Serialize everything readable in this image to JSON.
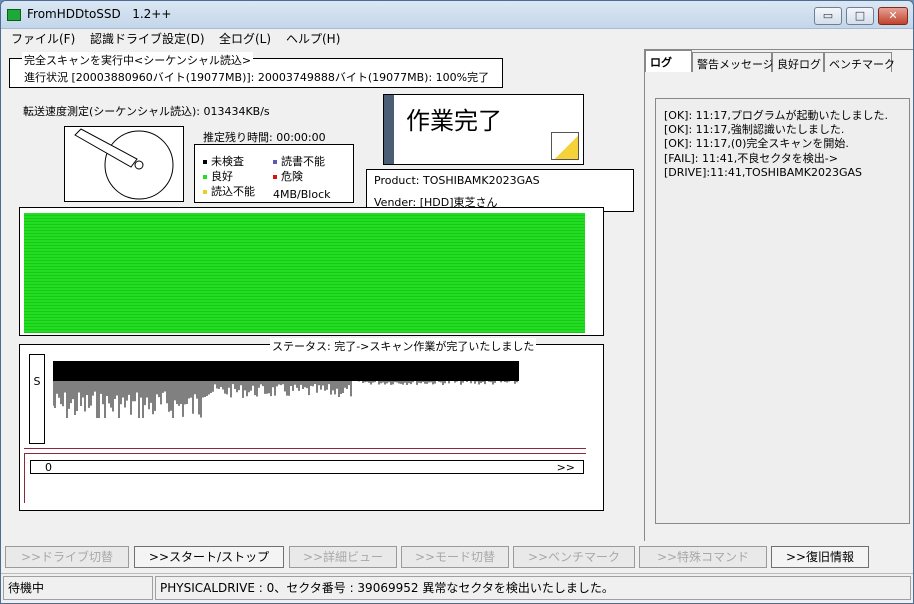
{
  "window": {
    "title": "FromHDDtoSSD   1.2++",
    "minimize_label": "▭",
    "maximize_label": "□",
    "close_label": "✕"
  },
  "menu": [
    "ファイル(F)",
    "認識ドライブ設定(D)",
    "全ログ(L)",
    "ヘルプ(H)"
  ],
  "scan": {
    "group_title": "完全スキャンを実行中<シーケンシャル読込>",
    "progress_text": "進行状況  [20003880960バイト(19077MB)]: 20003749888バイト(19077MB): 100%完了",
    "speed_text": "転送速度測定(シーケンシャル読込): 013434KB/s",
    "remaining_text": "推定残り時間: 00:00:00",
    "done_text": "作業完了"
  },
  "legend": {
    "items": [
      {
        "label": "未検査",
        "color": "#000000"
      },
      {
        "label": "読書不能",
        "color": "#5a5ab4"
      },
      {
        "label": "良好",
        "color": "#22dd22"
      },
      {
        "label": "危険",
        "color": "#dd1111"
      },
      {
        "label": "読込不能",
        "color": "#e8d020"
      }
    ],
    "block_size": "4MB/Block"
  },
  "drive_info": {
    "product": "Product: TOSHIBAMK2023GAS",
    "vender": "Vender: [HDD]東芝さん"
  },
  "status": {
    "title": "ステータス: 完了->スキャン作業が完了いたしました",
    "s_label": "S",
    "progress_start": "0",
    "progress_end": ">>"
  },
  "tabs": [
    "ログ",
    "警告メッセージ",
    "良好ログ",
    "ベンチマーク"
  ],
  "log": [
    "[OK]: 11:17,プログラムが起動いたしました.",
    "[OK]: 11:17,強制認識いたしました.",
    "[OK]: 11:17,(0)完全スキャンを開始.",
    "[FAIL]: 11:41,不良セクタを検出->",
    "[DRIVE]:11:41,TOSHIBAMK2023GAS"
  ],
  "buttons": [
    {
      "label": ">>ドライブ切替",
      "enabled": false
    },
    {
      "label": ">>スタート/ストップ",
      "enabled": true
    },
    {
      "label": ">>詳細ビュー",
      "enabled": false
    },
    {
      "label": ">>モード切替",
      "enabled": false
    },
    {
      "label": ">>ベンチマーク",
      "enabled": false
    },
    {
      "label": ">>特殊コマンド",
      "enabled": false
    },
    {
      "label": ">>復旧情報",
      "enabled": true
    }
  ],
  "statusbar": {
    "state": "待機中",
    "message": "PHYSICALDRIVE : 0、セクタ番号 : 39069952 異常なセクタを検出いたしました。"
  }
}
